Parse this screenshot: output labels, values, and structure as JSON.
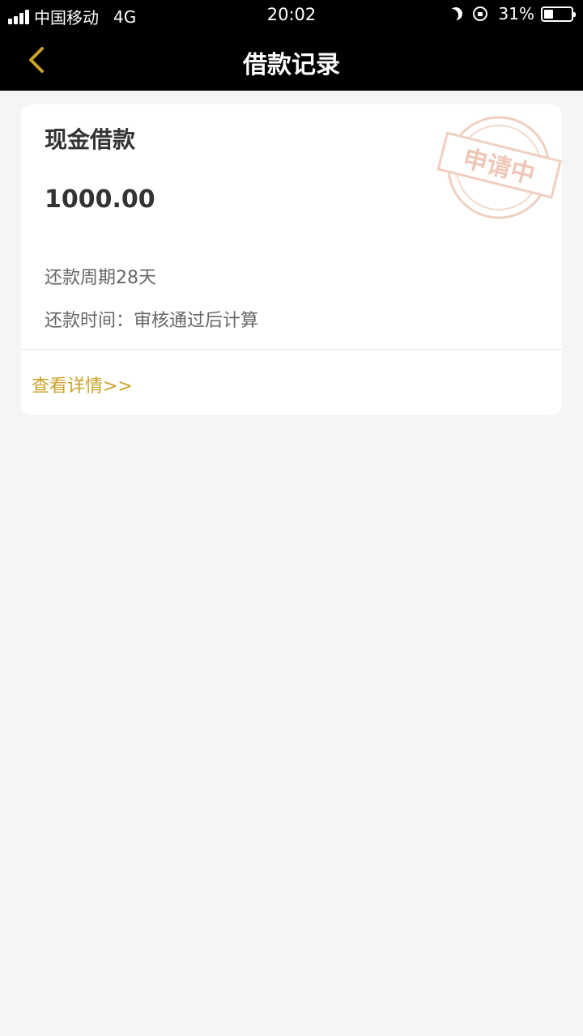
{
  "status_bar": {
    "carrier": "中国移动",
    "network": "4G",
    "time": "20:02",
    "battery": "31%"
  },
  "nav": {
    "title": "借款记录",
    "back_icon": "chevron-left-icon",
    "accent": "#c9a227"
  },
  "record": {
    "title": "现金借款",
    "amount": "1000.00",
    "period": "还款周期28天",
    "repay_time": "还款时间：审核通过后计算",
    "detail_link": "查看详情>>",
    "stamp_text": "申请中"
  }
}
